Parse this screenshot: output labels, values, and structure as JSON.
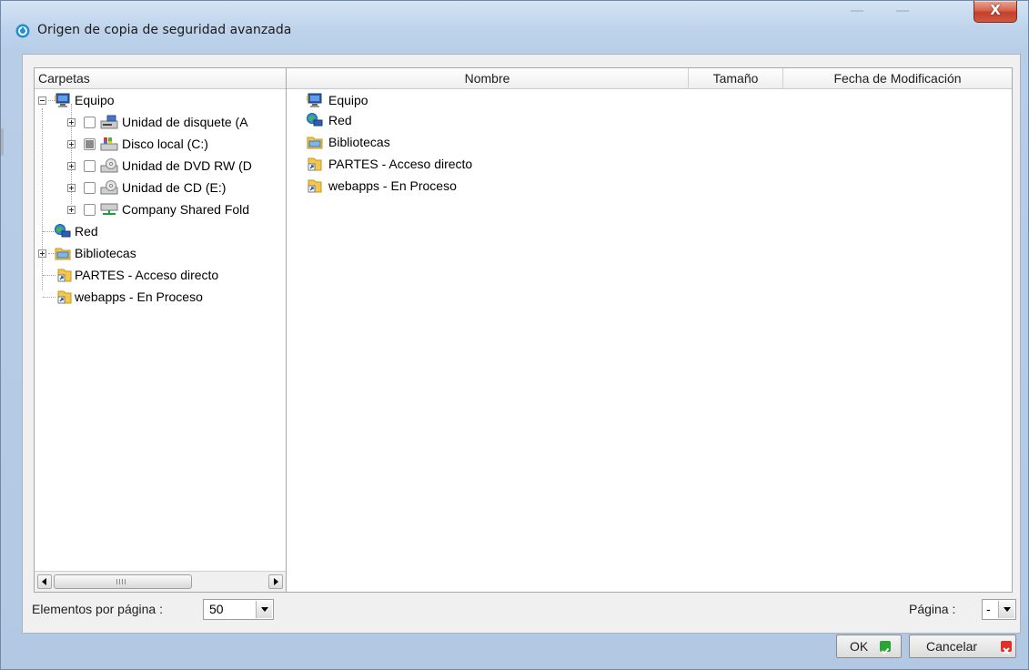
{
  "window": {
    "title": "Origen de copia de seguridad avanzada",
    "close_glyph": "X"
  },
  "tree": {
    "header": "Carpetas",
    "items": [
      {
        "label": "Equipo",
        "icon": "computer-icon",
        "expanded": true,
        "checkbox": false
      },
      {
        "label": "Unidad de disquete (A",
        "icon": "floppy-drive-icon",
        "checkbox": true,
        "checked": "unchecked"
      },
      {
        "label": "Disco local (C:)",
        "icon": "local-disk-icon",
        "checkbox": true,
        "checked": "partial"
      },
      {
        "label": "Unidad de DVD RW (D",
        "icon": "dvd-drive-icon",
        "checkbox": true,
        "checked": "unchecked"
      },
      {
        "label": "Unidad de CD (E:)",
        "icon": "cd-drive-icon",
        "checkbox": true,
        "checked": "unchecked"
      },
      {
        "label": "Company Shared Fold",
        "icon": "network-drive-icon",
        "checkbox": true,
        "checked": "unchecked"
      },
      {
        "label": "Red",
        "icon": "network-icon",
        "checkbox": false
      },
      {
        "label": "Bibliotecas",
        "icon": "libraries-icon",
        "expanded": false,
        "checkbox": false
      },
      {
        "label": "PARTES - Acceso directo",
        "icon": "shortcut-icon",
        "checkbox": false
      },
      {
        "label": "webapps - En Proceso",
        "icon": "shortcut-icon",
        "checkbox": false
      }
    ]
  },
  "list": {
    "columns": [
      "Nombre",
      "Tamaño",
      "Fecha de Modificación"
    ],
    "rows": [
      {
        "name": "Equipo",
        "icon": "computer-icon"
      },
      {
        "name": "Red",
        "icon": "network-icon"
      },
      {
        "name": "Bibliotecas",
        "icon": "libraries-icon"
      },
      {
        "name": "PARTES - Acceso directo",
        "icon": "shortcut-icon"
      },
      {
        "name": "webapps - En Proceso",
        "icon": "shortcut-icon"
      }
    ]
  },
  "footer": {
    "items_per_page_label": "Elementos por página :",
    "items_per_page_value": "50",
    "page_label": "Página :",
    "page_value": "-"
  },
  "buttons": {
    "ok": "OK",
    "cancel": "Cancelar"
  },
  "colors": {
    "ok_badge": "#2aa534",
    "cancel_badge": "#e0302a",
    "accent": "#1f8fd6"
  }
}
